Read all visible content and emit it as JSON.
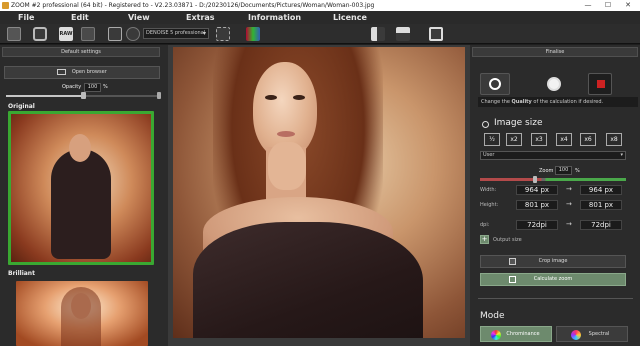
{
  "window": {
    "title": "ZOOM #2 professional (64 bit) - Registered to  - V2.23.03871 - D:/20230126/Documents/Pictures/Woman/Woman-003.jpg",
    "minimize_glyph": "—",
    "maximize_glyph": "☐",
    "close_glyph": "✕"
  },
  "menu": [
    "File",
    "Edit",
    "View",
    "Extras",
    "Information",
    "Licence"
  ],
  "toolbar": {
    "denoise_select": "DENOISE 5 professional",
    "icons": [
      "save-icon",
      "camera-icon",
      "raw-icon",
      "batch-icon",
      "settings-icon",
      "floppy-icon",
      "export-icon",
      "histogram-icon",
      "mirror-icon",
      "flip-icon",
      "crop-rotate-icon"
    ]
  },
  "left_panel": {
    "header": "Default settings",
    "open_browser": "Open browser",
    "opacity_label": "Opacity",
    "opacity_value": "100",
    "opacity_unit": "%",
    "opacity_fraction": 0.5,
    "presets": [
      {
        "name": "Original",
        "selected": true
      },
      {
        "name": "Brilliant",
        "selected": false
      }
    ]
  },
  "right_panel": {
    "header": "Finalise",
    "quality_hint_prefix": "Change the",
    "quality_hint_bold": "Quality",
    "quality_hint_suffix": "of the calculation if desired.",
    "image_size_title": "Image size",
    "multipliers": [
      "½",
      "x2",
      "x3",
      "x4",
      "x6",
      "x8"
    ],
    "user_select": "User",
    "zoom_label": "Zoom",
    "zoom_value": "100",
    "zoom_unit": "%",
    "width_label": "Width:",
    "width_from": "964 px",
    "width_to": "964 px",
    "height_label": "Height:",
    "height_from": "801 px",
    "height_to": "801 px",
    "dpi_label": "dpi:",
    "dpi_from": "72dpi",
    "dpi_to": "72dpi",
    "arrow": "→",
    "output_size_label": "Output size",
    "crop_image": "Crop image",
    "calculate_zoom": "Calculate zoom",
    "mode_title": "Mode",
    "mode_chrominance": "Chrominance",
    "mode_spectral": "Spectral"
  },
  "colors": {
    "accent_green": "#3aa832",
    "calc_button_bg": "#6d8a6d",
    "zoom_bar_left": "#b34a4a",
    "zoom_bar_right": "#4aa84a"
  }
}
